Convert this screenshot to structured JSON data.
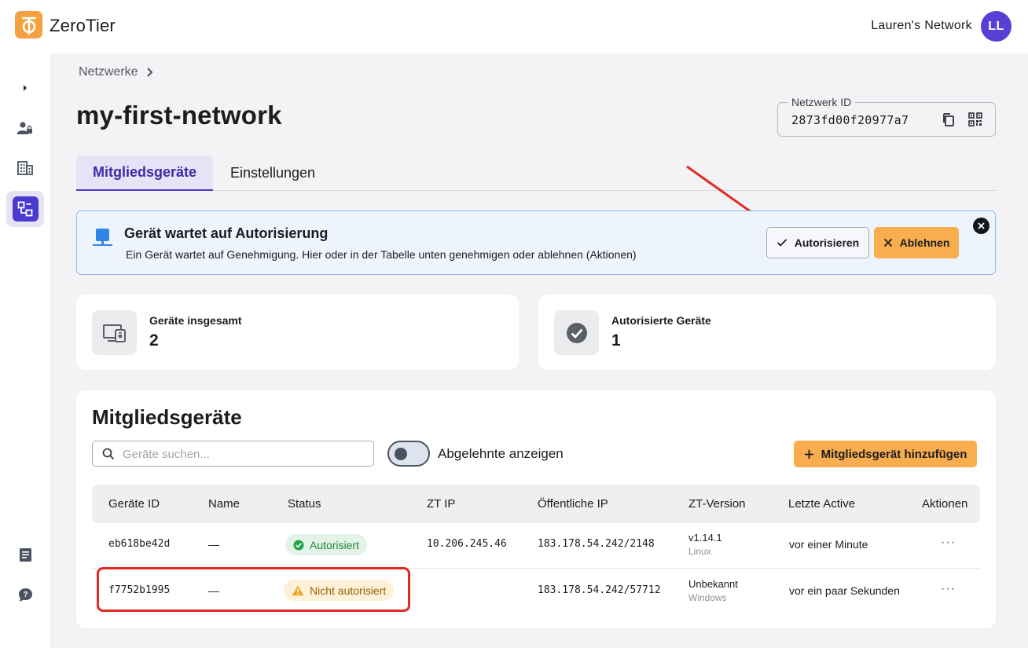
{
  "app": {
    "brand": "ZeroTier",
    "network_name": "Lauren's Network",
    "avatar_initials": "LL",
    "accent": "#4b3ad0",
    "brand_color": "#f5a13f"
  },
  "breadcrumb": {
    "root": "Netzwerke"
  },
  "page": {
    "title": "my-first-network"
  },
  "network_id": {
    "label": "Netzwerk ID",
    "value": "2873fd00f20977a7"
  },
  "tabs": [
    {
      "label": "Mitgliedsgeräte",
      "active": true
    },
    {
      "label": "Einstellungen",
      "active": false
    }
  ],
  "alert": {
    "title": "Gerät wartet auf Autorisierung",
    "text": "Ein Gerät wartet auf Genehmigung. Hier oder in der Tabelle unten genehmigen oder ablehnen (Aktionen)",
    "authorize_label": "Autorisieren",
    "reject_label": "Ablehnen"
  },
  "stats": [
    {
      "label": "Geräte insgesamt",
      "value": "2"
    },
    {
      "label": "Autorisierte Geräte",
      "value": "1"
    }
  ],
  "members": {
    "title": "Mitgliedsgeräte",
    "search_placeholder": "Geräte suchen...",
    "toggle_label": "Abgelehnte anzeigen",
    "add_label": "Mitgliedsgerät hinzufügen",
    "columns": [
      "Geräte ID",
      "Name",
      "Status",
      "ZT IP",
      "Öffentliche IP",
      "ZT-Version",
      "Letzte Active",
      "Aktionen"
    ],
    "rows": [
      {
        "id": "eb618be42d",
        "name": "—",
        "status": "Autorisiert",
        "zt_ip": "10.206.245.46",
        "public_ip": "183.178.54.242/2148",
        "version": "v1.14.1",
        "os": "Linux",
        "last_active": "vor einer Minute",
        "actions": "···"
      },
      {
        "id": "f7752b1995",
        "name": "—",
        "status": "Nicht autorisiert",
        "zt_ip": "",
        "public_ip": "183.178.54.242/57712",
        "version": "Unbekannt",
        "os": "Windows",
        "last_active": "vor ein paar Sekunden",
        "actions": "···"
      }
    ]
  }
}
